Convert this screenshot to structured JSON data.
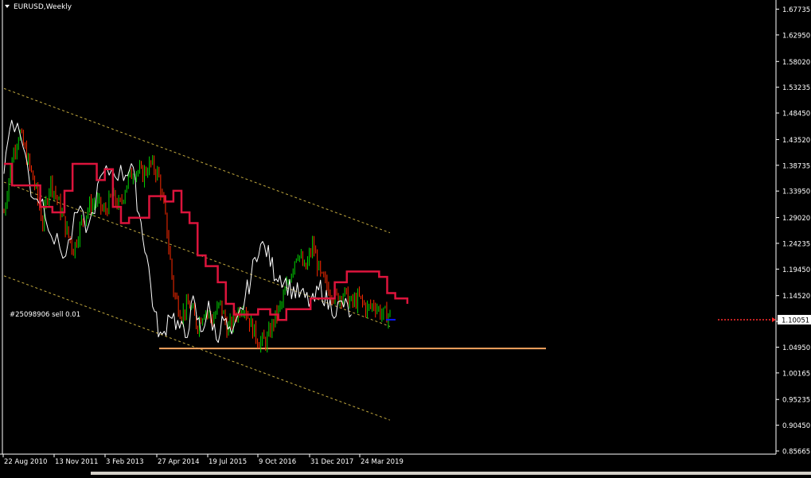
{
  "chart_title": "EURUSD,Weekly",
  "chart_data": {
    "type": "candlestick",
    "symbol": "EURUSD",
    "timeframe": "Weekly",
    "ylim": [
      0.8552,
      1.687
    ],
    "price_axis_ticks": [
      "1.67735",
      "1.62950",
      "1.58020",
      "1.53235",
      "1.48450",
      "1.43520",
      "1.38735",
      "1.33950",
      "1.29020",
      "1.24235",
      "1.19450",
      "1.14520",
      "1.09735",
      "1.04950",
      "1.00165",
      "0.95235",
      "0.90450",
      "0.85665"
    ],
    "time_axis_ticks": [
      "22 Aug 2010",
      "13 Nov 2011",
      "3 Feb 2013",
      "27 Apr 2014",
      "19 Jul 2015",
      "9 Oct 2016",
      "31 Dec 2017",
      "24 Mar 2019"
    ],
    "current_price": "1.10051",
    "horizontal_level": 1.047,
    "channel": {
      "upper": [
        [
          0.0,
          1.53
        ],
        [
          1.0,
          1.262
        ]
      ],
      "middle": [
        [
          0.0,
          1.356
        ],
        [
          1.0,
          1.088
        ]
      ],
      "lower": [
        [
          0.0,
          1.182
        ],
        [
          1.0,
          0.914
        ]
      ]
    },
    "price_path": [
      [
        0.0,
        1.3
      ],
      [
        0.02,
        1.4
      ],
      [
        0.04,
        1.45
      ],
      [
        0.06,
        1.4
      ],
      [
        0.08,
        1.35
      ],
      [
        0.1,
        1.28
      ],
      [
        0.12,
        1.36
      ],
      [
        0.14,
        1.32
      ],
      [
        0.16,
        1.27
      ],
      [
        0.18,
        1.23
      ],
      [
        0.2,
        1.28
      ],
      [
        0.22,
        1.31
      ],
      [
        0.24,
        1.32
      ],
      [
        0.26,
        1.3
      ],
      [
        0.28,
        1.33
      ],
      [
        0.3,
        1.31
      ],
      [
        0.32,
        1.36
      ],
      [
        0.34,
        1.38
      ],
      [
        0.36,
        1.37
      ],
      [
        0.38,
        1.39
      ],
      [
        0.4,
        1.37
      ],
      [
        0.42,
        1.28
      ],
      [
        0.44,
        1.15
      ],
      [
        0.46,
        1.11
      ],
      [
        0.48,
        1.13
      ],
      [
        0.5,
        1.09
      ],
      [
        0.52,
        1.12
      ],
      [
        0.54,
        1.1
      ],
      [
        0.56,
        1.13
      ],
      [
        0.58,
        1.08
      ],
      [
        0.6,
        1.11
      ],
      [
        0.62,
        1.13
      ],
      [
        0.64,
        1.09
      ],
      [
        0.66,
        1.06
      ],
      [
        0.68,
        1.06
      ],
      [
        0.7,
        1.1
      ],
      [
        0.72,
        1.13
      ],
      [
        0.74,
        1.18
      ],
      [
        0.76,
        1.23
      ],
      [
        0.78,
        1.19
      ],
      [
        0.8,
        1.24
      ],
      [
        0.82,
        1.18
      ],
      [
        0.84,
        1.16
      ],
      [
        0.86,
        1.14
      ],
      [
        0.88,
        1.15
      ],
      [
        0.9,
        1.13
      ],
      [
        0.92,
        1.14
      ],
      [
        0.94,
        1.12
      ],
      [
        0.96,
        1.13
      ],
      [
        0.98,
        1.11
      ],
      [
        1.0,
        1.11
      ]
    ],
    "lagging_line": [
      [
        0.0,
        1.38
      ],
      [
        0.02,
        1.48
      ],
      [
        0.05,
        1.43
      ],
      [
        0.07,
        1.34
      ],
      [
        0.1,
        1.32
      ],
      [
        0.13,
        1.25
      ],
      [
        0.16,
        1.22
      ],
      [
        0.19,
        1.3
      ],
      [
        0.22,
        1.27
      ],
      [
        0.25,
        1.36
      ],
      [
        0.28,
        1.38
      ],
      [
        0.31,
        1.37
      ],
      [
        0.33,
        1.39
      ],
      [
        0.35,
        1.3
      ],
      [
        0.37,
        1.22
      ],
      [
        0.39,
        1.11
      ],
      [
        0.41,
        1.06
      ],
      [
        0.43,
        1.12
      ],
      [
        0.45,
        1.09
      ],
      [
        0.47,
        1.07
      ],
      [
        0.49,
        1.13
      ],
      [
        0.51,
        1.08
      ],
      [
        0.53,
        1.12
      ],
      [
        0.55,
        1.07
      ],
      [
        0.57,
        1.1
      ],
      [
        0.59,
        1.06
      ],
      [
        0.62,
        1.13
      ],
      [
        0.64,
        1.18
      ],
      [
        0.66,
        1.24
      ],
      [
        0.68,
        1.23
      ],
      [
        0.7,
        1.19
      ],
      [
        0.72,
        1.18
      ],
      [
        0.74,
        1.16
      ],
      [
        0.76,
        1.15
      ],
      [
        0.78,
        1.14
      ],
      [
        0.8,
        1.13
      ],
      [
        0.82,
        1.16
      ],
      [
        0.84,
        1.13
      ],
      [
        0.86,
        1.12
      ],
      [
        0.88,
        1.13
      ],
      [
        0.9,
        1.11
      ]
    ],
    "kijun_line": [
      [
        0.0,
        1.39
      ],
      [
        0.02,
        1.35
      ],
      [
        0.06,
        1.35
      ],
      [
        0.09,
        1.31
      ],
      [
        0.12,
        1.3
      ],
      [
        0.15,
        1.34
      ],
      [
        0.17,
        1.39
      ],
      [
        0.2,
        1.39
      ],
      [
        0.23,
        1.36
      ],
      [
        0.25,
        1.38
      ],
      [
        0.27,
        1.31
      ],
      [
        0.29,
        1.28
      ],
      [
        0.31,
        1.29
      ],
      [
        0.34,
        1.29
      ],
      [
        0.36,
        1.33
      ],
      [
        0.4,
        1.32
      ],
      [
        0.42,
        1.34
      ],
      [
        0.44,
        1.3
      ],
      [
        0.46,
        1.28
      ],
      [
        0.48,
        1.22
      ],
      [
        0.5,
        1.2
      ],
      [
        0.53,
        1.17
      ],
      [
        0.55,
        1.13
      ],
      [
        0.57,
        1.11
      ],
      [
        0.6,
        1.11
      ],
      [
        0.63,
        1.12
      ],
      [
        0.66,
        1.11
      ],
      [
        0.68,
        1.1
      ],
      [
        0.7,
        1.12
      ],
      [
        0.74,
        1.12
      ],
      [
        0.76,
        1.14
      ],
      [
        0.78,
        1.14
      ],
      [
        0.8,
        1.14
      ],
      [
        0.82,
        1.17
      ],
      [
        0.85,
        1.19
      ],
      [
        0.88,
        1.19
      ],
      [
        0.9,
        1.19
      ],
      [
        0.93,
        1.18
      ],
      [
        0.95,
        1.15
      ],
      [
        0.97,
        1.14
      ],
      [
        1.0,
        1.13
      ]
    ],
    "order_label": "#25098906 sell 0.01",
    "colors": {
      "background": "#000000",
      "axis_text": "#ffffff",
      "bull_candle": "#00d400",
      "bear_candle": "#ff2a00",
      "lagging_line": "#ffffff",
      "kijun_line": "#dc143c",
      "channel": "#e6c84a",
      "level_line": "#f4a460",
      "order_line": "#ff2a2a",
      "price_marker": "#0a16ff"
    }
  }
}
